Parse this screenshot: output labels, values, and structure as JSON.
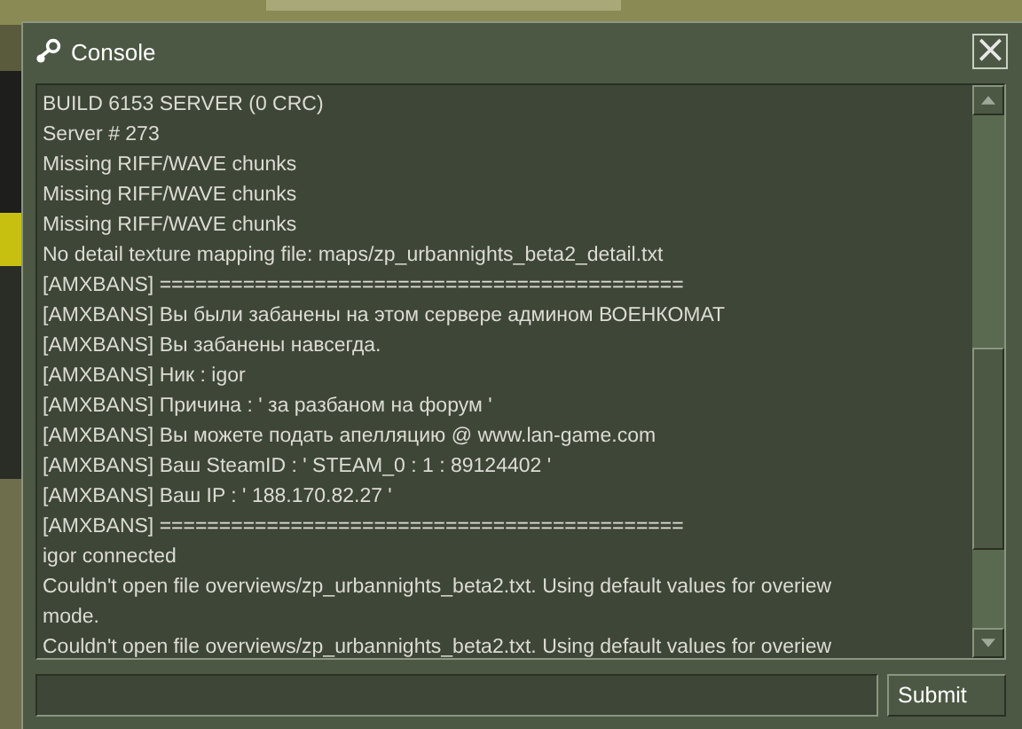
{
  "window": {
    "title": "Console",
    "close": "×"
  },
  "console": {
    "lines": [
      "BUILD 6153 SERVER (0 CRC)",
      "Server # 273",
      "Missing RIFF/WAVE chunks",
      "Missing RIFF/WAVE chunks",
      "Missing RIFF/WAVE chunks",
      "No detail texture mapping file: maps/zp_urbannights_beta2_detail.txt",
      "[AMXBANS] ============================================",
      "[AMXBANS] Вы были забанены на этом сервере админом ВОЕНКОМАТ",
      "[AMXBANS] Вы забанены навсегда.",
      "[AMXBANS] Ник : igor",
      "[AMXBANS] Причина : ' за разбаном на форум '",
      "[AMXBANS] Вы можете подать апелляцию @ www.lan-game.com",
      "[AMXBANS] Ваш SteamID : ' STEAM_0 : 1 : 89124402 '",
      "[AMXBANS] Ваш IP : ' 188.170.82.27 '",
      "[AMXBANS] ============================================",
      "igor connected",
      "Couldn't open file overviews/zp_urbannights_beta2.txt. Using default values for overiew",
      "mode.",
      "Couldn't open file overviews/zp_urbannights_beta2.txt. Using default values for overiew"
    ]
  },
  "command": {
    "button": "Submit"
  }
}
